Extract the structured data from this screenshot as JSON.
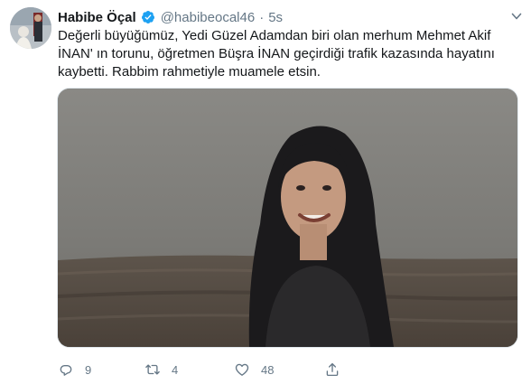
{
  "tweet": {
    "author_name": "Habibe Öçal",
    "handle": "@habibeocal46",
    "separator": "·",
    "time": "5s",
    "text_lines": [
      "Değerli büyüğümüz, Yedi Güzel Adamdan biri olan merhum Mehmet Akif",
      "İNAN' ın torunu, öğretmen Büşra İNAN geçirdiği trafik kazasında hayatını",
      "kaybetti. Rabbim rahmetiyle muamele etsin."
    ]
  },
  "actions": {
    "reply_count": "9",
    "retweet_count": "4",
    "like_count": "48"
  },
  "icons": {
    "verified": "verified-badge-icon",
    "caret": "chevron-down-icon",
    "reply": "reply-icon",
    "retweet": "retweet-icon",
    "like": "heart-icon",
    "share": "share-icon"
  },
  "colors": {
    "verified": "#1da1f2",
    "secondary_text": "#657786",
    "primary_text": "#14171a"
  }
}
